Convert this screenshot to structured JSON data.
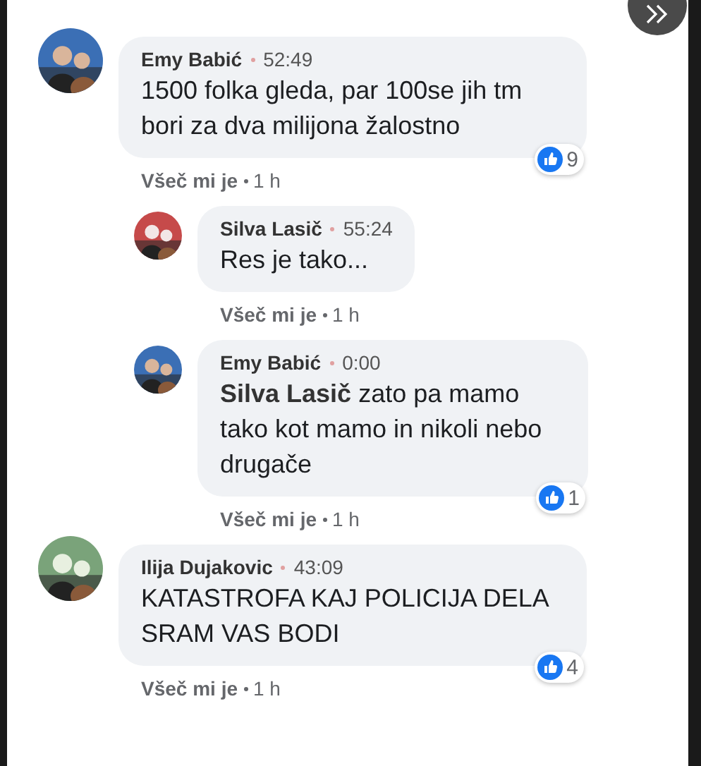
{
  "comments": [
    {
      "author": "Emy Babić",
      "time": "52:49",
      "text": "1500 folka gleda, par 100se jih tm bori za dva milijona žalostno",
      "reactions": "9",
      "like": "Všeč mi je",
      "age": "1 h",
      "children": [
        {
          "author": "Silva Lasič",
          "time": "55:24",
          "text": "Res je tako...",
          "like": "Všeč mi je",
          "age": "1 h"
        },
        {
          "author": "Emy Babić",
          "time": "0:00",
          "text": "**Silva Lasič** zato pa mamo tako kot mamo in nikoli nebo drugače",
          "reactions": "1",
          "like": "Všeč mi je",
          "age": "1 h"
        }
      ]
    },
    {
      "author": "Ilija Dujakovic",
      "time": "43:09",
      "text": "KATASTROFA KAJ POLICIJA DELA SRAM VAS BODI",
      "reactions": "4",
      "like": "Všeč mi je",
      "age": "1 h"
    }
  ]
}
